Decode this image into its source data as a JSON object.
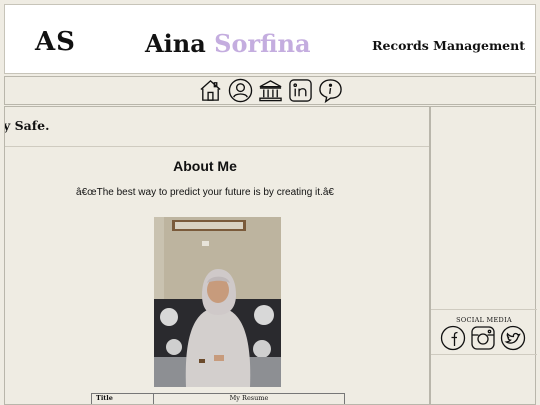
{
  "header": {
    "initials": "AS",
    "brand_first": "Aina",
    "brand_last": "Sorfina",
    "tagline": "Records Management"
  },
  "nav": [
    {
      "icon": "home-icon"
    },
    {
      "icon": "user-icon"
    },
    {
      "icon": "bank-icon"
    },
    {
      "icon": "linkedin-icon"
    },
    {
      "icon": "info-icon"
    }
  ],
  "main": {
    "marquee": "y Safe.",
    "about_title": "About Me",
    "quote": "â€œThe best way to predict your future is by creating it.â€",
    "table": {
      "header": "Title",
      "value": "My Resume"
    }
  },
  "side": {
    "social_label": "SOCIAL MEDIA",
    "icons": [
      "facebook-icon",
      "instagram-icon",
      "twitter-icon"
    ]
  },
  "colors": {
    "background": "#efece3",
    "brand_accent": "#c4addf",
    "header_bg": "#ffffff"
  }
}
